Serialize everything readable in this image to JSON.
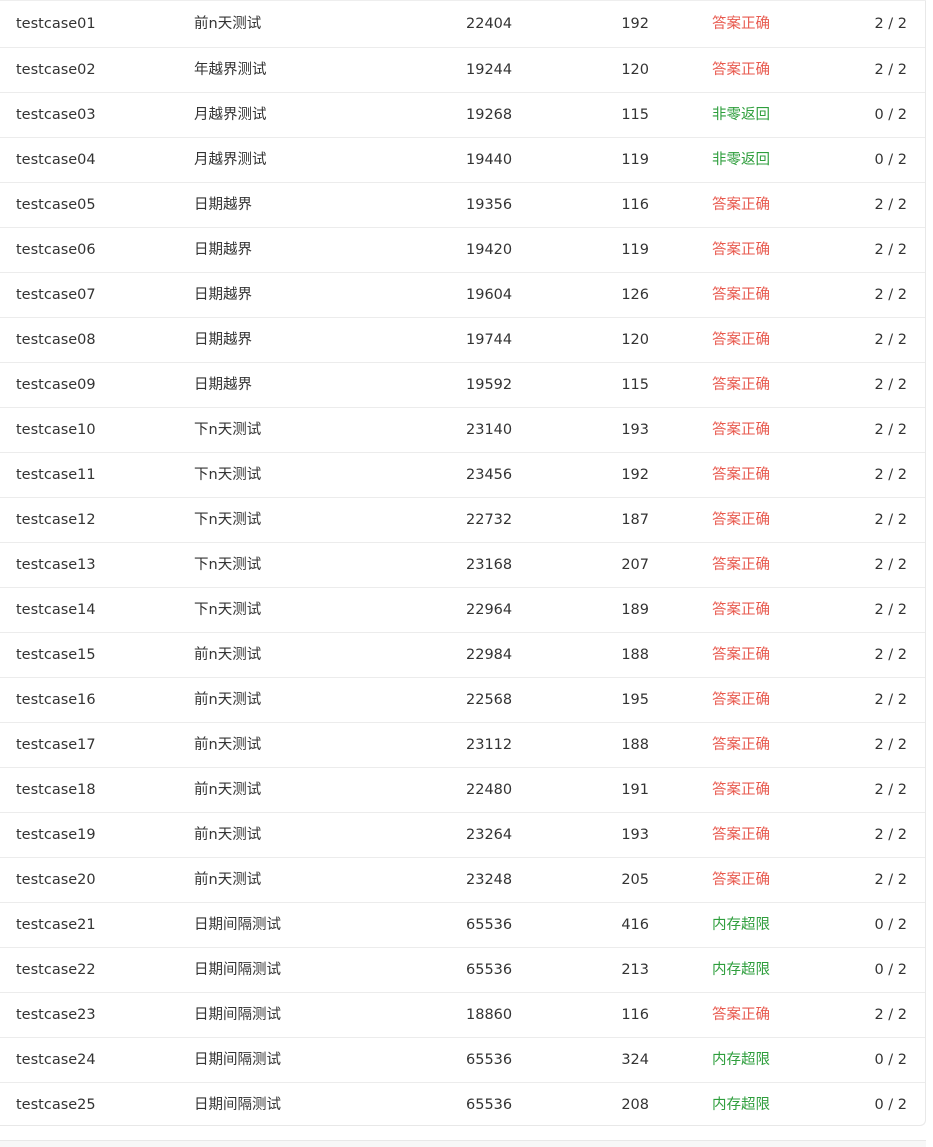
{
  "colors": {
    "accepted": "#e85a4f",
    "failed": "#2e9e3c"
  },
  "testcases": [
    {
      "name": "testcase01",
      "desc": "前n天测试",
      "memory": "22404",
      "time": "192",
      "status": "答案正确",
      "status_kind": "accepted",
      "score": "2 / 2"
    },
    {
      "name": "testcase02",
      "desc": "年越界测试",
      "memory": "19244",
      "time": "120",
      "status": "答案正确",
      "status_kind": "accepted",
      "score": "2 / 2"
    },
    {
      "name": "testcase03",
      "desc": "月越界测试",
      "memory": "19268",
      "time": "115",
      "status": "非零返回",
      "status_kind": "failed",
      "score": "0 / 2"
    },
    {
      "name": "testcase04",
      "desc": "月越界测试",
      "memory": "19440",
      "time": "119",
      "status": "非零返回",
      "status_kind": "failed",
      "score": "0 / 2"
    },
    {
      "name": "testcase05",
      "desc": "日期越界",
      "memory": "19356",
      "time": "116",
      "status": "答案正确",
      "status_kind": "accepted",
      "score": "2 / 2"
    },
    {
      "name": "testcase06",
      "desc": "日期越界",
      "memory": "19420",
      "time": "119",
      "status": "答案正确",
      "status_kind": "accepted",
      "score": "2 / 2"
    },
    {
      "name": "testcase07",
      "desc": "日期越界",
      "memory": "19604",
      "time": "126",
      "status": "答案正确",
      "status_kind": "accepted",
      "score": "2 / 2"
    },
    {
      "name": "testcase08",
      "desc": "日期越界",
      "memory": "19744",
      "time": "120",
      "status": "答案正确",
      "status_kind": "accepted",
      "score": "2 / 2"
    },
    {
      "name": "testcase09",
      "desc": "日期越界",
      "memory": "19592",
      "time": "115",
      "status": "答案正确",
      "status_kind": "accepted",
      "score": "2 / 2"
    },
    {
      "name": "testcase10",
      "desc": "下n天测试",
      "memory": "23140",
      "time": "193",
      "status": "答案正确",
      "status_kind": "accepted",
      "score": "2 / 2"
    },
    {
      "name": "testcase11",
      "desc": "下n天测试",
      "memory": "23456",
      "time": "192",
      "status": "答案正确",
      "status_kind": "accepted",
      "score": "2 / 2"
    },
    {
      "name": "testcase12",
      "desc": "下n天测试",
      "memory": "22732",
      "time": "187",
      "status": "答案正确",
      "status_kind": "accepted",
      "score": "2 / 2"
    },
    {
      "name": "testcase13",
      "desc": "下n天测试",
      "memory": "23168",
      "time": "207",
      "status": "答案正确",
      "status_kind": "accepted",
      "score": "2 / 2"
    },
    {
      "name": "testcase14",
      "desc": "下n天测试",
      "memory": "22964",
      "time": "189",
      "status": "答案正确",
      "status_kind": "accepted",
      "score": "2 / 2"
    },
    {
      "name": "testcase15",
      "desc": "前n天测试",
      "memory": "22984",
      "time": "188",
      "status": "答案正确",
      "status_kind": "accepted",
      "score": "2 / 2"
    },
    {
      "name": "testcase16",
      "desc": "前n天测试",
      "memory": "22568",
      "time": "195",
      "status": "答案正确",
      "status_kind": "accepted",
      "score": "2 / 2"
    },
    {
      "name": "testcase17",
      "desc": "前n天测试",
      "memory": "23112",
      "time": "188",
      "status": "答案正确",
      "status_kind": "accepted",
      "score": "2 / 2"
    },
    {
      "name": "testcase18",
      "desc": "前n天测试",
      "memory": "22480",
      "time": "191",
      "status": "答案正确",
      "status_kind": "accepted",
      "score": "2 / 2"
    },
    {
      "name": "testcase19",
      "desc": "前n天测试",
      "memory": "23264",
      "time": "193",
      "status": "答案正确",
      "status_kind": "accepted",
      "score": "2 / 2"
    },
    {
      "name": "testcase20",
      "desc": "前n天测试",
      "memory": "23248",
      "time": "205",
      "status": "答案正确",
      "status_kind": "accepted",
      "score": "2 / 2"
    },
    {
      "name": "testcase21",
      "desc": "日期间隔测试",
      "memory": "65536",
      "time": "416",
      "status": "内存超限",
      "status_kind": "failed",
      "score": "0 / 2"
    },
    {
      "name": "testcase22",
      "desc": "日期间隔测试",
      "memory": "65536",
      "time": "213",
      "status": "内存超限",
      "status_kind": "failed",
      "score": "0 / 2"
    },
    {
      "name": "testcase23",
      "desc": "日期间隔测试",
      "memory": "18860",
      "time": "116",
      "status": "答案正确",
      "status_kind": "accepted",
      "score": "2 / 2"
    },
    {
      "name": "testcase24",
      "desc": "日期间隔测试",
      "memory": "65536",
      "time": "324",
      "status": "内存超限",
      "status_kind": "failed",
      "score": "0 / 2"
    },
    {
      "name": "testcase25",
      "desc": "日期间隔测试",
      "memory": "65536",
      "time": "208",
      "status": "内存超限",
      "status_kind": "failed",
      "score": "0 / 2"
    }
  ]
}
